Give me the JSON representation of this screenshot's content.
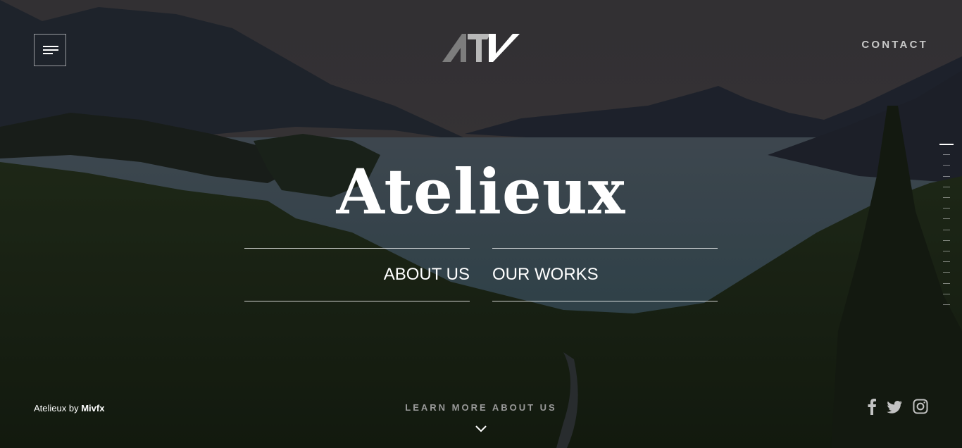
{
  "header": {
    "menu_icon": "hamburger-icon",
    "logo_text": "ATV",
    "contact_label": "CONTACT"
  },
  "hero": {
    "title": "Atelieux",
    "about_label": "ABOUT US",
    "works_label": "OUR WORKS"
  },
  "pager": {
    "count": 16,
    "active_index": 0
  },
  "footer": {
    "credit_prefix": "Atelieux by",
    "credit_author": "Mivfx",
    "learn_more_label": "LEARN MORE ABOUT US",
    "scroll_icon": "chevron-down-icon",
    "social": [
      "facebook-icon",
      "twitter-icon",
      "instagram-icon"
    ]
  },
  "colors": {
    "overlay": "#000000",
    "text": "#ffffff",
    "muted": "#c7c7c7"
  }
}
